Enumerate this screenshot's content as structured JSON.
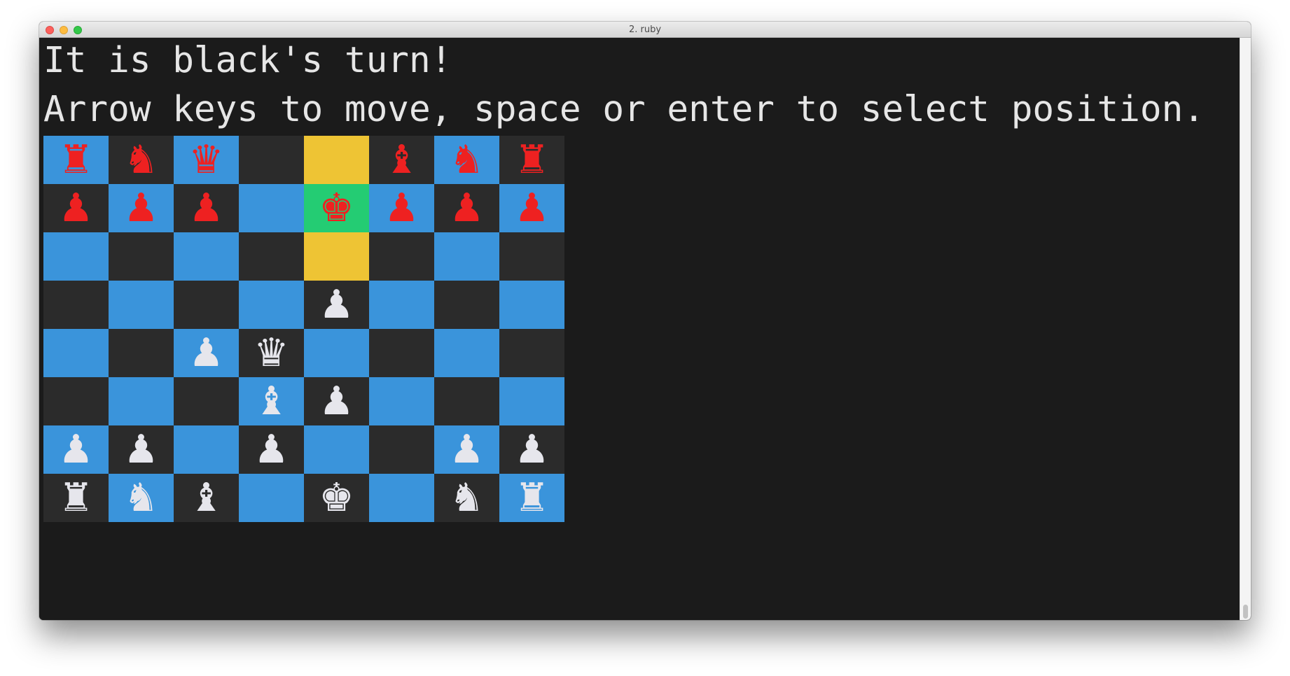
{
  "window": {
    "title": "2. ruby"
  },
  "terminal": {
    "status_line": "It is black's turn!",
    "instructions_line": "Arrow keys to move, space or enter to select position."
  },
  "colors": {
    "light_square": "#3a94db",
    "dark_square": "#2b2b2b",
    "highlight_square": "#eec434",
    "cursor_square": "#24cc73",
    "red_piece": "#ee2121",
    "white_piece": "#e6e6ec",
    "terminal_bg": "#1b1b1b"
  },
  "board": {
    "rows": [
      [
        {
          "piece": "♜",
          "side": "red",
          "name": "rook",
          "bg": "blue"
        },
        {
          "piece": "♞",
          "side": "red",
          "name": "knight",
          "bg": "dark"
        },
        {
          "piece": "♛",
          "side": "red",
          "name": "queen",
          "bg": "blue"
        },
        {
          "piece": "",
          "side": "",
          "name": "empty",
          "bg": "dark"
        },
        {
          "piece": "",
          "side": "",
          "name": "empty",
          "bg": "highlight"
        },
        {
          "piece": "♝",
          "side": "red",
          "name": "bishop",
          "bg": "dark"
        },
        {
          "piece": "♞",
          "side": "red",
          "name": "knight",
          "bg": "blue"
        },
        {
          "piece": "♜",
          "side": "red",
          "name": "rook",
          "bg": "dark"
        }
      ],
      [
        {
          "piece": "♟",
          "side": "red",
          "name": "pawn",
          "bg": "dark"
        },
        {
          "piece": "♟",
          "side": "red",
          "name": "pawn",
          "bg": "blue"
        },
        {
          "piece": "♟",
          "side": "red",
          "name": "pawn",
          "bg": "dark"
        },
        {
          "piece": "",
          "side": "",
          "name": "empty",
          "bg": "blue"
        },
        {
          "piece": "♚",
          "side": "red",
          "name": "king",
          "bg": "cursor"
        },
        {
          "piece": "♟",
          "side": "red",
          "name": "pawn",
          "bg": "blue"
        },
        {
          "piece": "♟",
          "side": "red",
          "name": "pawn",
          "bg": "dark"
        },
        {
          "piece": "♟",
          "side": "red",
          "name": "pawn",
          "bg": "blue"
        }
      ],
      [
        {
          "piece": "",
          "side": "",
          "name": "empty",
          "bg": "blue"
        },
        {
          "piece": "",
          "side": "",
          "name": "empty",
          "bg": "dark"
        },
        {
          "piece": "",
          "side": "",
          "name": "empty",
          "bg": "blue"
        },
        {
          "piece": "",
          "side": "",
          "name": "empty",
          "bg": "dark"
        },
        {
          "piece": "",
          "side": "",
          "name": "empty",
          "bg": "highlight"
        },
        {
          "piece": "",
          "side": "",
          "name": "empty",
          "bg": "dark"
        },
        {
          "piece": "",
          "side": "",
          "name": "empty",
          "bg": "blue"
        },
        {
          "piece": "",
          "side": "",
          "name": "empty",
          "bg": "dark"
        }
      ],
      [
        {
          "piece": "",
          "side": "",
          "name": "empty",
          "bg": "dark"
        },
        {
          "piece": "",
          "side": "",
          "name": "empty",
          "bg": "blue"
        },
        {
          "piece": "",
          "side": "",
          "name": "empty",
          "bg": "dark"
        },
        {
          "piece": "",
          "side": "",
          "name": "empty",
          "bg": "blue"
        },
        {
          "piece": "♟",
          "side": "white",
          "name": "pawn",
          "bg": "dark"
        },
        {
          "piece": "",
          "side": "",
          "name": "empty",
          "bg": "blue"
        },
        {
          "piece": "",
          "side": "",
          "name": "empty",
          "bg": "dark"
        },
        {
          "piece": "",
          "side": "",
          "name": "empty",
          "bg": "blue"
        }
      ],
      [
        {
          "piece": "",
          "side": "",
          "name": "empty",
          "bg": "blue"
        },
        {
          "piece": "",
          "side": "",
          "name": "empty",
          "bg": "dark"
        },
        {
          "piece": "♟",
          "side": "white",
          "name": "pawn",
          "bg": "blue"
        },
        {
          "piece": "♛",
          "side": "white",
          "name": "queen",
          "bg": "dark"
        },
        {
          "piece": "",
          "side": "",
          "name": "empty",
          "bg": "blue"
        },
        {
          "piece": "",
          "side": "",
          "name": "empty",
          "bg": "dark"
        },
        {
          "piece": "",
          "side": "",
          "name": "empty",
          "bg": "blue"
        },
        {
          "piece": "",
          "side": "",
          "name": "empty",
          "bg": "dark"
        }
      ],
      [
        {
          "piece": "",
          "side": "",
          "name": "empty",
          "bg": "dark"
        },
        {
          "piece": "",
          "side": "",
          "name": "empty",
          "bg": "blue"
        },
        {
          "piece": "",
          "side": "",
          "name": "empty",
          "bg": "dark"
        },
        {
          "piece": "♝",
          "side": "white",
          "name": "bishop",
          "bg": "blue"
        },
        {
          "piece": "♟",
          "side": "white",
          "name": "pawn",
          "bg": "dark"
        },
        {
          "piece": "",
          "side": "",
          "name": "empty",
          "bg": "blue"
        },
        {
          "piece": "",
          "side": "",
          "name": "empty",
          "bg": "dark"
        },
        {
          "piece": "",
          "side": "",
          "name": "empty",
          "bg": "blue"
        }
      ],
      [
        {
          "piece": "♟",
          "side": "white",
          "name": "pawn",
          "bg": "blue"
        },
        {
          "piece": "♟",
          "side": "white",
          "name": "pawn",
          "bg": "dark"
        },
        {
          "piece": "",
          "side": "",
          "name": "empty",
          "bg": "blue"
        },
        {
          "piece": "♟",
          "side": "white",
          "name": "pawn",
          "bg": "dark"
        },
        {
          "piece": "",
          "side": "",
          "name": "empty",
          "bg": "blue"
        },
        {
          "piece": "",
          "side": "",
          "name": "empty",
          "bg": "dark"
        },
        {
          "piece": "♟",
          "side": "white",
          "name": "pawn",
          "bg": "blue"
        },
        {
          "piece": "♟",
          "side": "white",
          "name": "pawn",
          "bg": "dark"
        }
      ],
      [
        {
          "piece": "♜",
          "side": "white",
          "name": "rook",
          "bg": "dark"
        },
        {
          "piece": "♞",
          "side": "white",
          "name": "knight",
          "bg": "blue"
        },
        {
          "piece": "♝",
          "side": "white",
          "name": "bishop",
          "bg": "dark"
        },
        {
          "piece": "",
          "side": "",
          "name": "empty",
          "bg": "blue"
        },
        {
          "piece": "♚",
          "side": "white",
          "name": "king",
          "bg": "dark"
        },
        {
          "piece": "",
          "side": "",
          "name": "empty",
          "bg": "blue"
        },
        {
          "piece": "♞",
          "side": "white",
          "name": "knight",
          "bg": "dark"
        },
        {
          "piece": "♜",
          "side": "white",
          "name": "rook",
          "bg": "blue"
        }
      ]
    ]
  }
}
